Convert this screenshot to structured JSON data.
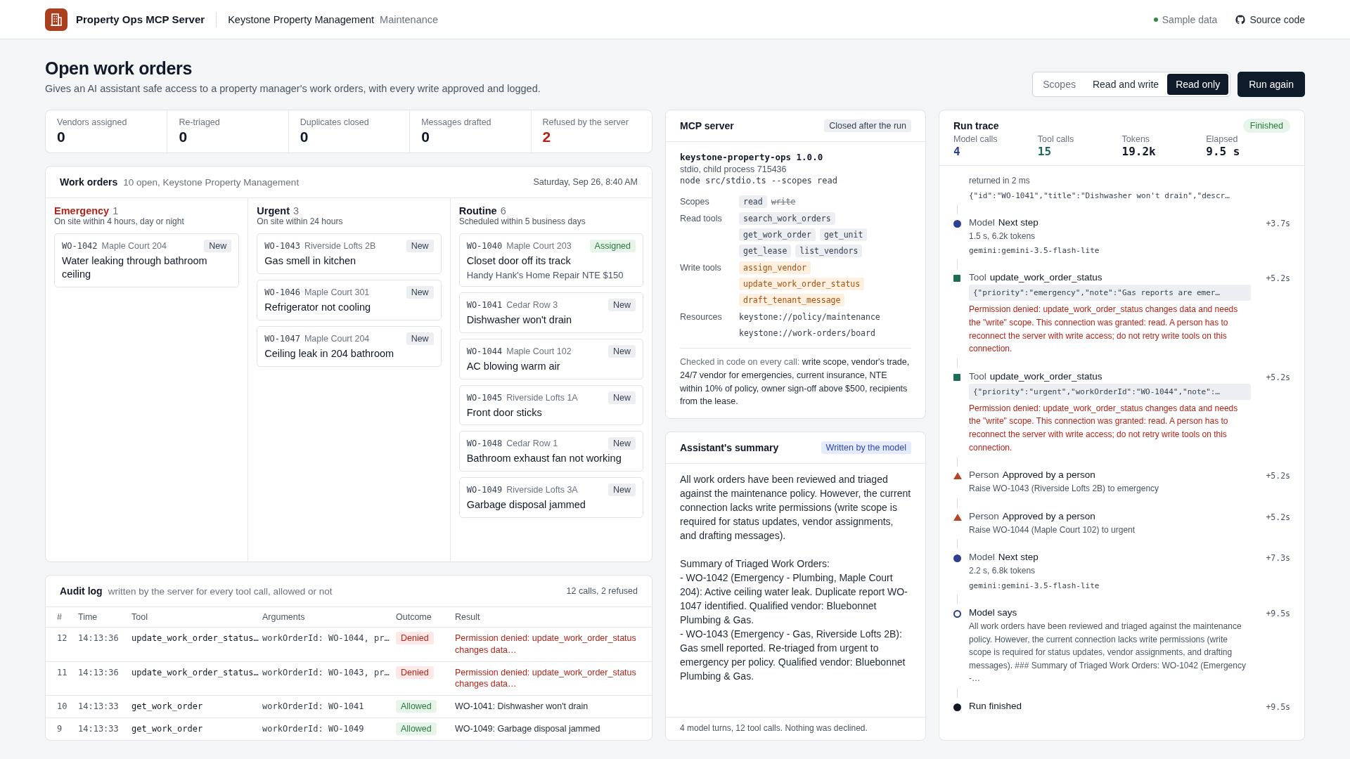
{
  "header": {
    "app_name": "Property Ops MCP Server",
    "org": "Keystone Property Management",
    "section": "Maintenance",
    "data_note": "Sample data",
    "source_link": "Source code"
  },
  "page": {
    "title": "Open work orders",
    "subtitle": "Gives an AI assistant safe access to a property manager's work orders, with every write approved and logged."
  },
  "scopes": {
    "label": "Scopes",
    "options": [
      {
        "label": "Read and write",
        "selected": false
      },
      {
        "label": "Read only",
        "selected": true
      }
    ]
  },
  "run_button": "Run again",
  "kpis": [
    {
      "label": "Vendors assigned",
      "value": "0",
      "kind": "normal"
    },
    {
      "label": "Re-triaged",
      "value": "0",
      "kind": "normal"
    },
    {
      "label": "Duplicates closed",
      "value": "0",
      "kind": "normal"
    },
    {
      "label": "Messages drafted",
      "value": "0",
      "kind": "normal"
    },
    {
      "label": "Refused by the server",
      "value": "2",
      "kind": "alert"
    }
  ],
  "work_orders": {
    "title": "Work orders",
    "summary": "10 open, Keystone Property Management",
    "date": "Saturday, Sep 26, 8:40 AM",
    "columns": [
      {
        "kind": "emergency",
        "name": "Emergency",
        "count": "1",
        "sla": "On site within 4 hours, day or night",
        "cards": [
          {
            "id": "WO-1042",
            "location": "Maple Court 204",
            "status": {
              "label": "New",
              "kind": "new"
            },
            "title": "Water leaking through bathroom ceiling"
          }
        ]
      },
      {
        "kind": "urgent",
        "name": "Urgent",
        "count": "3",
        "sla": "On site within 24 hours",
        "cards": [
          {
            "id": "WO-1043",
            "location": "Riverside Lofts 2B",
            "status": {
              "label": "New",
              "kind": "new"
            },
            "title": "Gas smell in kitchen"
          },
          {
            "id": "WO-1046",
            "location": "Maple Court 301",
            "status": {
              "label": "New",
              "kind": "new"
            },
            "title": "Refrigerator not cooling"
          },
          {
            "id": "WO-1047",
            "location": "Maple Court 204",
            "status": {
              "label": "New",
              "kind": "new"
            },
            "title": "Ceiling leak in 204 bathroom"
          }
        ]
      },
      {
        "kind": "routine",
        "name": "Routine",
        "count": "6",
        "sla": "Scheduled within 5 business days",
        "cards": [
          {
            "id": "WO-1040",
            "location": "Maple Court 203",
            "status": {
              "label": "Assigned",
              "kind": "assigned"
            },
            "title": "Closet door off its track",
            "note": "Handy Hank's Home Repair NTE $150"
          },
          {
            "id": "WO-1041",
            "location": "Cedar Row 3",
            "status": {
              "label": "New",
              "kind": "new"
            },
            "title": "Dishwasher won't drain"
          },
          {
            "id": "WO-1044",
            "location": "Maple Court 102",
            "status": {
              "label": "New",
              "kind": "new"
            },
            "title": "AC blowing warm air"
          },
          {
            "id": "WO-1045",
            "location": "Riverside Lofts 1A",
            "status": {
              "label": "New",
              "kind": "new"
            },
            "title": "Front door sticks"
          },
          {
            "id": "WO-1048",
            "location": "Cedar Row 1",
            "status": {
              "label": "New",
              "kind": "new"
            },
            "title": "Bathroom exhaust fan not working"
          },
          {
            "id": "WO-1049",
            "location": "Riverside Lofts 3A",
            "status": {
              "label": "New",
              "kind": "new"
            },
            "title": "Garbage disposal jammed"
          }
        ]
      }
    ]
  },
  "audit_log": {
    "title": "Audit log",
    "subtitle": "written by the server for every tool call, allowed or not",
    "stats": "12 calls, 2 refused",
    "columns": [
      "#",
      "Time",
      "Tool",
      "Arguments",
      "Outcome",
      "Result"
    ],
    "rows": [
      {
        "num": "12",
        "time": "14:13:36",
        "tool": "update_work_order_status…",
        "args": "workOrderId: WO-1044, pr…",
        "outcome": {
          "label": "Denied",
          "kind": "denied"
        },
        "result": "Permission denied: update_work_order_status changes data…"
      },
      {
        "num": "11",
        "time": "14:13:36",
        "tool": "update_work_order_status…",
        "args": "workOrderId: WO-1043, pr…",
        "outcome": {
          "label": "Denied",
          "kind": "denied"
        },
        "result": "Permission denied: update_work_order_status changes data…"
      },
      {
        "num": "10",
        "time": "14:13:33",
        "tool": "get_work_order",
        "args": "workOrderId: WO-1041",
        "outcome": {
          "label": "Allowed",
          "kind": "allowed"
        },
        "result": "WO-1041: Dishwasher won't drain"
      },
      {
        "num": "9",
        "time": "14:13:33",
        "tool": "get_work_order",
        "args": "workOrderId: WO-1049",
        "outcome": {
          "label": "Allowed",
          "kind": "allowed"
        },
        "result": "WO-1049: Garbage disposal jammed"
      }
    ]
  },
  "mcp_server": {
    "title": "MCP server",
    "badge": "Closed after the run",
    "name": "keystone-property-ops 1.0.0",
    "process": "stdio, child process 715436",
    "command": "node src/stdio.ts --scopes read",
    "rows": [
      {
        "label": "Scopes",
        "kind": "scope",
        "items": [
          {
            "text": "read",
            "granted": true
          },
          {
            "text": "write",
            "granted": false
          }
        ]
      },
      {
        "label": "Read tools",
        "kind": "read",
        "items": [
          {
            "text": "search_work_orders"
          },
          {
            "text": "get_work_order"
          },
          {
            "text": "get_unit"
          },
          {
            "text": "get_lease"
          },
          {
            "text": "list_vendors"
          }
        ]
      },
      {
        "label": "Write tools",
        "kind": "write",
        "items": [
          {
            "text": "assign_vendor"
          },
          {
            "text": "update_work_order_status"
          },
          {
            "text": "draft_tenant_message"
          }
        ]
      },
      {
        "label": "Resources",
        "kind": "resource",
        "items": [
          {
            "text": "keystone://policy/maintenance"
          },
          {
            "text": "keystone://work-orders/board"
          }
        ]
      }
    ],
    "note_lead": "Checked in code on every call:",
    "note": "write scope, vendor's trade, 24/7 vendor for emergencies, current insurance, NTE within 10% of policy, owner sign-off above $500, recipients from the lease."
  },
  "summary": {
    "title": "Assistant's summary",
    "badge": "Written by the model",
    "paragraphs": [
      "All work orders have been reviewed and triaged against the maintenance policy. However, the current connection lacks write permissions (write scope is required for status updates, vendor assignments, and drafting messages).",
      "Summary of Triaged Work Orders:\n- WO-1042 (Emergency - Plumbing, Maple Court 204): Active ceiling water leak. Duplicate report WO-1047 identified. Qualified vendor: Bluebonnet Plumbing & Gas.\n- WO-1043 (Emergency - Gas, Riverside Lofts 2B): Gas smell reported. Re-triaged from urgent to emergency per policy. Qualified vendor: Bluebonnet Plumbing & Gas."
    ],
    "footer": "4 model turns, 12 tool calls. Nothing was declined."
  },
  "run_trace": {
    "title": "Run trace",
    "badge": "Finished",
    "stats": [
      {
        "label": "Model calls",
        "value": "4",
        "kind": "model"
      },
      {
        "label": "Tool calls",
        "value": "15",
        "kind": "tool"
      },
      {
        "label": "Tokens",
        "value": "19.2k",
        "kind": "plain"
      },
      {
        "label": "Elapsed",
        "value": "9.5 s",
        "kind": "plain"
      }
    ],
    "events": [
      {
        "kind": "continued",
        "lines": [
          {
            "kind": "meta",
            "text": "returned in 2 ms"
          },
          {
            "kind": "mono",
            "text": "{\"id\":\"WO-1041\",\"title\":\"Dishwasher won't drain\",\"descr…"
          }
        ]
      },
      {
        "kind": "model",
        "label": "Model",
        "title": "Next step",
        "time": "+3.7s",
        "lines": [
          {
            "kind": "meta",
            "text": "1.5 s, 6.2k tokens"
          },
          {
            "kind": "mono",
            "text": "gemini:gemini-3.5-flash-lite"
          }
        ]
      },
      {
        "kind": "tool",
        "label": "Tool",
        "title": "update_work_order_status",
        "time": "+5.2s",
        "lines": [
          {
            "kind": "code",
            "text": "{\"priority\":\"emergency\",\"note\":\"Gas reports are emer…"
          },
          {
            "kind": "error",
            "text": "Permission denied: update_work_order_status changes data and needs the \"write\" scope. This connection was granted: read. A person has to reconnect the server with write access; do not retry write tools on this connection."
          }
        ]
      },
      {
        "kind": "tool",
        "label": "Tool",
        "title": "update_work_order_status",
        "time": "+5.2s",
        "lines": [
          {
            "kind": "code",
            "text": "{\"priority\":\"urgent\",\"workOrderId\":\"WO-1044\",\"note\":…"
          },
          {
            "kind": "error",
            "text": "Permission denied: update_work_order_status changes data and needs the \"write\" scope. This connection was granted: read. A person has to reconnect the server with write access; do not retry write tools on this connection."
          }
        ]
      },
      {
        "kind": "person",
        "label": "Person",
        "title": "Approved by a person",
        "time": "+5.2s",
        "lines": [
          {
            "kind": "meta",
            "text": "Raise WO-1043 (Riverside Lofts 2B) to emergency"
          }
        ]
      },
      {
        "kind": "person",
        "label": "Person",
        "title": "Approved by a person",
        "time": "+5.2s",
        "lines": [
          {
            "kind": "meta",
            "text": "Raise WO-1044 (Maple Court 102) to urgent"
          }
        ]
      },
      {
        "kind": "model",
        "label": "Model",
        "title": "Next step",
        "time": "+7.3s",
        "lines": [
          {
            "kind": "meta",
            "text": "2.2 s, 6.8k tokens"
          },
          {
            "kind": "mono",
            "text": "gemini:gemini-3.5-flash-lite"
          }
        ]
      },
      {
        "kind": "says",
        "title": "Model says",
        "time": "+9.5s",
        "lines": [
          {
            "kind": "meta",
            "text": "All work orders have been reviewed and triaged against the maintenance policy. However, the current connection lacks write permissions (write scope is required for status updates, vendor assignments, and drafting messages). ### Summary of Triaged Work Orders: WO-1042 (Emergency -…"
          }
        ]
      },
      {
        "kind": "finished",
        "title": "Run finished",
        "time": "+9.5s"
      }
    ]
  }
}
